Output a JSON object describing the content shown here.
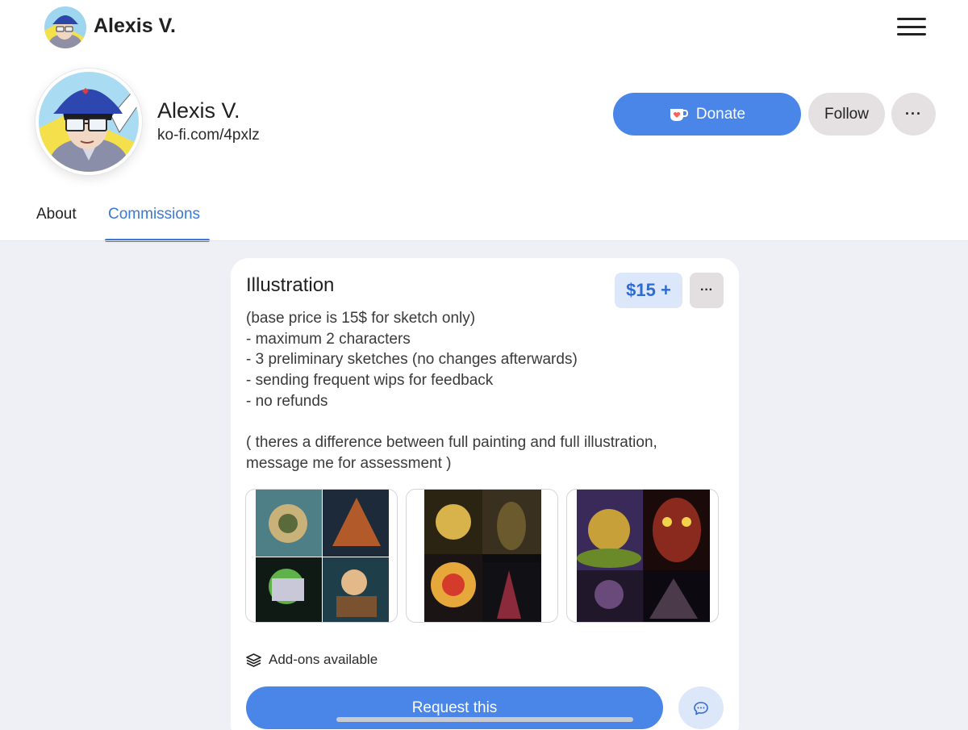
{
  "header": {
    "name": "Alexis V.",
    "menu_icon": "hamburger-menu-icon"
  },
  "profile": {
    "name": "Alexis V.",
    "url": "ko-fi.com/4pxlz",
    "donate_label": "Donate",
    "follow_label": "Follow",
    "more_label": "···"
  },
  "tabs": [
    {
      "label": "About",
      "active": false
    },
    {
      "label": "Commissions",
      "active": true
    }
  ],
  "commission": {
    "title": "Illustration",
    "price": "$15 +",
    "more_label": "···",
    "description": [
      "(base price is 15$ for sketch only)",
      "- maximum 2 characters",
      "- 3 preliminary sketches (no changes afterwards)",
      "- sending frequent wips for feedback",
      "- no refunds",
      "",
      "( theres a difference between full painting and full illustration,",
      "message me for assessment )"
    ],
    "addons_label": "Add-ons available",
    "request_label": "Request this"
  },
  "colors": {
    "accent": "#4a86e8",
    "tab_active": "#3b78d8",
    "price_bg": "#dde7fa",
    "page_bg": "#eef0f5"
  }
}
